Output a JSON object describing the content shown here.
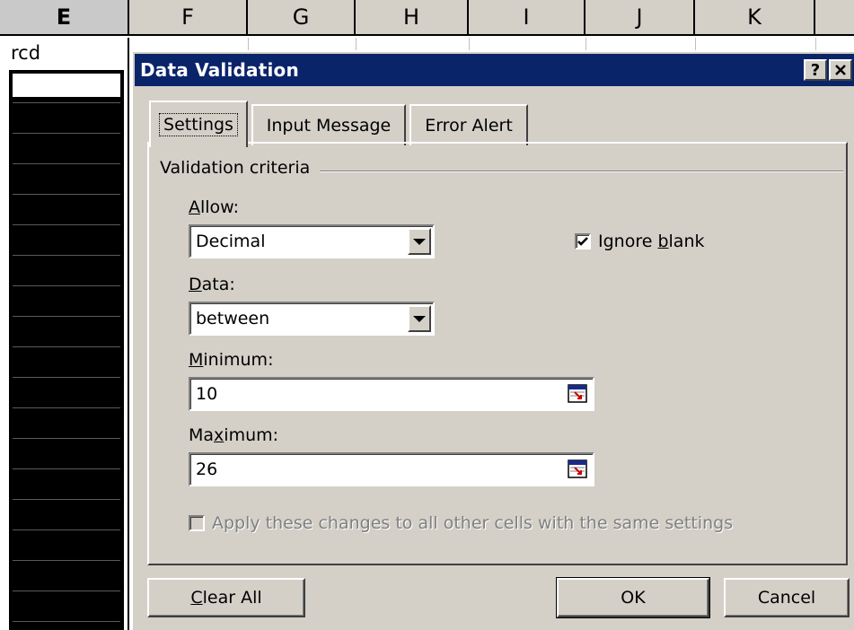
{
  "spreadsheet": {
    "columns": [
      "E",
      "F",
      "G",
      "H",
      "I",
      "J",
      "K"
    ],
    "selected_column": "E",
    "cell_e_text": "rcd"
  },
  "dialog": {
    "title": "Data Validation",
    "help_button": "?",
    "close_button": "×",
    "tabs": [
      {
        "label": "Settings",
        "active": true
      },
      {
        "label": "Input Message",
        "active": false
      },
      {
        "label": "Error Alert",
        "active": false
      }
    ],
    "group_label": "Validation criteria",
    "allow": {
      "label_underlined": "A",
      "label_rest": "llow:",
      "value": "Decimal"
    },
    "ignore_blank": {
      "label_pre": "Ignore ",
      "label_underlined": "b",
      "label_rest": "lank",
      "checked": true
    },
    "data": {
      "label_underlined": "D",
      "label_rest": "ata:",
      "value": "between"
    },
    "minimum": {
      "label_pre": "",
      "label_underlined": "M",
      "label_rest": "inimum:",
      "value": "10"
    },
    "maximum": {
      "label_pre": "Ma",
      "label_underlined": "x",
      "label_rest": "imum:",
      "value": "26"
    },
    "apply_all": {
      "label": "Apply these changes to all other cells with the same settings",
      "checked": false,
      "enabled": false
    },
    "buttons": {
      "clear_all_underlined": "C",
      "clear_all_rest": "lear All",
      "ok": "OK",
      "cancel": "Cancel"
    }
  }
}
